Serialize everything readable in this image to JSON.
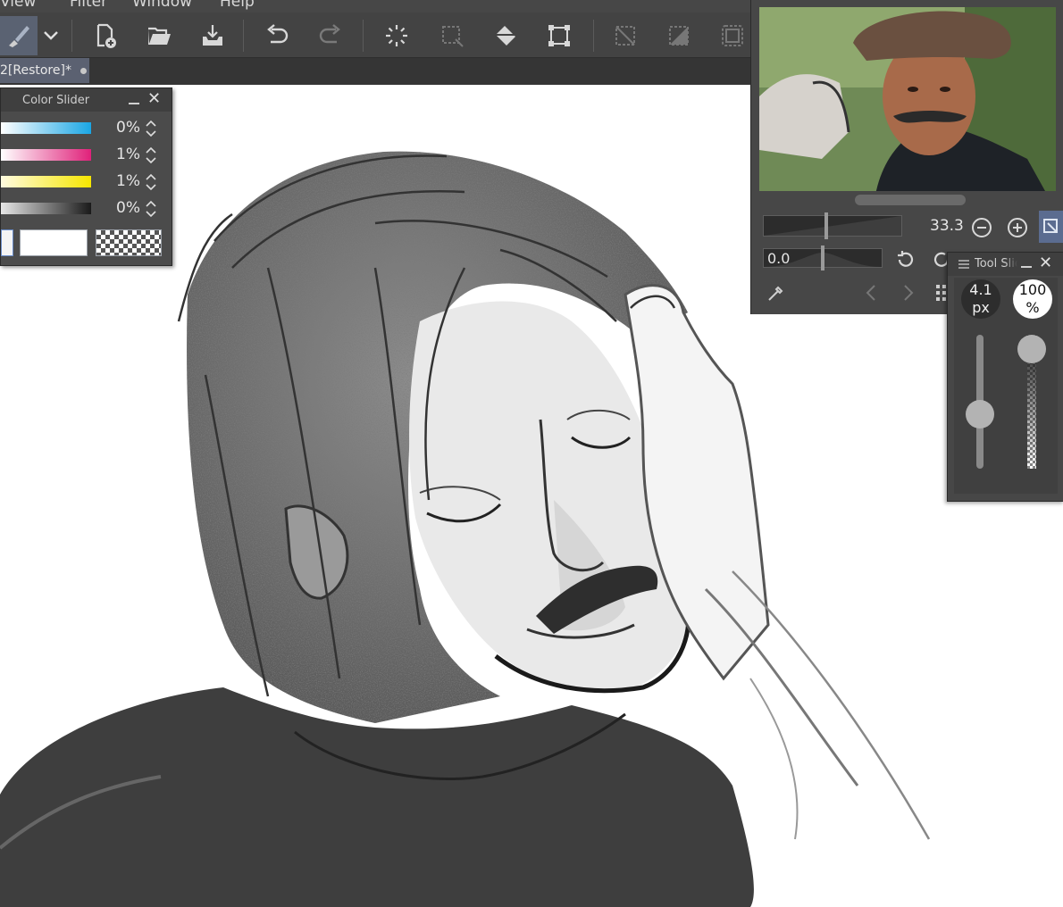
{
  "menu": {
    "items": [
      "View",
      "Filter",
      "Window",
      "Help"
    ]
  },
  "toolbar": {
    "buttons": [
      "brush-tool",
      "dropdown",
      "new-canvas",
      "open-file",
      "save",
      "undo",
      "redo",
      "select-all",
      "clear-selection",
      "fill",
      "transform",
      "hide-selection",
      "invert-selection",
      "selection-border"
    ]
  },
  "tab": {
    "title": "2[Restore]*"
  },
  "color_slider": {
    "title": "Color Slider",
    "rows": [
      {
        "value": "0%",
        "color": "#1aa6e4"
      },
      {
        "value": "1%",
        "color": "#e0217a"
      },
      {
        "value": "1%",
        "color": "#f6e600"
      },
      {
        "value": "0%",
        "color": "#1a1a1a"
      }
    ]
  },
  "navigator": {
    "zoom_value": "33.3",
    "zoom_level": 0.45,
    "rotation_value": "0.0"
  },
  "tool_slider": {
    "title": "Tool Slider",
    "size_value": "4.1",
    "size_unit": "px",
    "opacity_value": "100",
    "opacity_unit": "%",
    "size_level": 0.38,
    "opacity_level": 1.0
  },
  "colors": {
    "panel_bg": "#474747",
    "accent": "#5b6171"
  }
}
